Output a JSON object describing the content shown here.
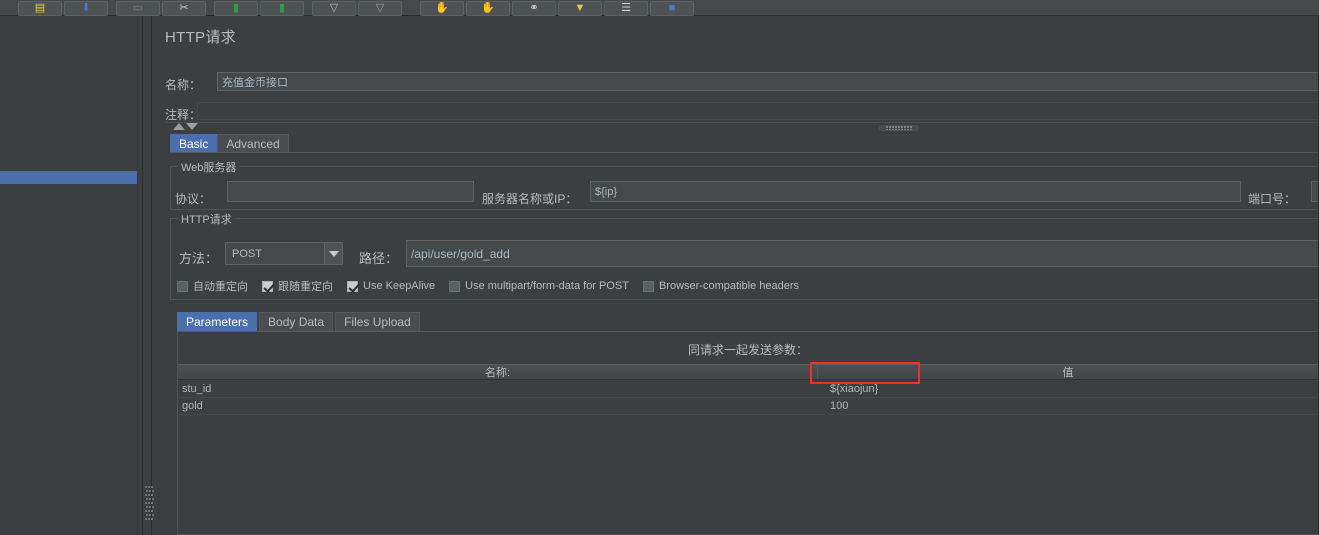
{
  "window": {
    "bg_color": "#3c3f41",
    "accent_color": "#4b6eaf",
    "highlight_color": "#ee3322"
  },
  "toolbar": {
    "buttons": [
      {
        "name": "new-plan-icon",
        "glyph": "▤",
        "color": "#e8c84a"
      },
      {
        "name": "open-template-icon",
        "glyph": "⬇",
        "color": "#4a7ec0"
      },
      {
        "name": "save-icon",
        "glyph": "▭",
        "color": "#808080"
      },
      {
        "name": "cut-icon",
        "glyph": "✂",
        "color": "#cccccc"
      },
      {
        "name": "copy-icon",
        "glyph": "▮",
        "color": "#2f9e44"
      },
      {
        "name": "paste-icon",
        "glyph": "▮",
        "color": "#2f9e44"
      },
      {
        "name": "expand-all-icon",
        "glyph": "▽",
        "color": "#b9bdbe"
      },
      {
        "name": "collapse-all-icon",
        "glyph": "▽",
        "color": "#9a9e9f"
      },
      {
        "name": "toggle-icon",
        "glyph": "✋",
        "color": "#e09a4a"
      },
      {
        "name": "start-icon",
        "glyph": "✋",
        "color": "#e09a4a"
      },
      {
        "name": "remote-start-icon",
        "glyph": "⚭",
        "color": "#d6d6d6"
      },
      {
        "name": "clear-icon",
        "glyph": "▼",
        "color": "#e8c84a"
      },
      {
        "name": "search-icon",
        "glyph": "☰",
        "color": "#d6d6d6"
      },
      {
        "name": "function-helper-icon",
        "glyph": "■",
        "color": "#4a7ec0"
      }
    ]
  },
  "left_panel": {
    "name": "test-plan-tree",
    "selected_row_visible": true
  },
  "main": {
    "page_title": "HTTP请求",
    "name_label": "名称：",
    "name_value": "充值金币接口",
    "comment_label": "注释：",
    "comment_value": "",
    "tabs": [
      {
        "label": "Basic",
        "selected": true
      },
      {
        "label": "Advanced",
        "selected": false
      }
    ],
    "web_server": {
      "group_title": "Web服务器",
      "protocol_label": "协议：",
      "protocol_value": "",
      "host_label": "服务器名称或IP：",
      "host_value": "${ip}",
      "port_label": "端口号：",
      "port_value": ""
    },
    "http_request": {
      "group_title": "HTTP请求",
      "method_label": "方法：",
      "method_value": "POST",
      "path_label": "路径：",
      "path_value": "/api/user/gold_add",
      "checkboxes": [
        {
          "label": "自动重定向",
          "checked": false
        },
        {
          "label": "跟随重定向",
          "checked": true
        },
        {
          "label": "Use KeepAlive",
          "checked": true
        },
        {
          "label": "Use multipart/form-data for POST",
          "checked": false
        },
        {
          "label": "Browser-compatible headers",
          "checked": false
        }
      ]
    },
    "param_tabs": [
      {
        "label": "Parameters",
        "selected": true
      },
      {
        "label": "Body Data",
        "selected": false
      },
      {
        "label": "Files Upload",
        "selected": false
      }
    ],
    "params_table": {
      "caption": "同请求一起发送参数：",
      "columns": [
        "名称:",
        "值"
      ],
      "rows": [
        {
          "name": "stu_id",
          "value": "${xiaojun}",
          "highlighted": true
        },
        {
          "name": "gold",
          "value": "100",
          "highlighted": false
        }
      ]
    }
  }
}
